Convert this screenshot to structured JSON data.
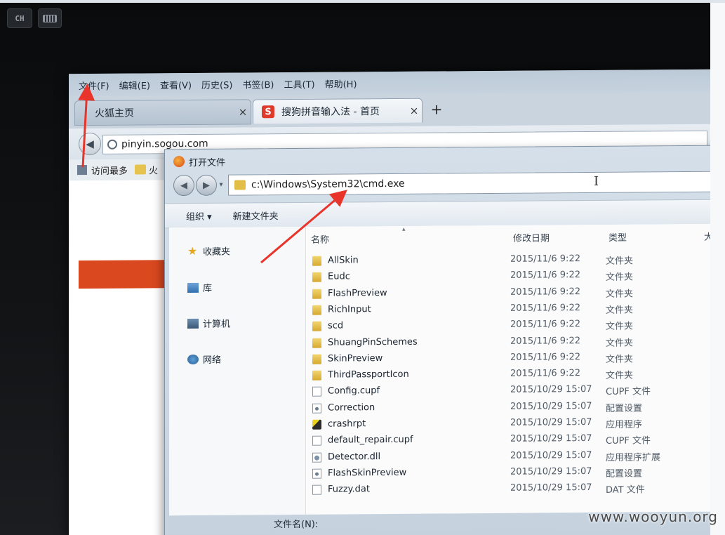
{
  "keyboard": {
    "lang": "CH"
  },
  "browser": {
    "menu": [
      "文件(F)",
      "编辑(E)",
      "查看(V)",
      "历史(S)",
      "书签(B)",
      "工具(T)",
      "帮助(H)"
    ],
    "tabs": [
      {
        "label": "火狐主页",
        "close": "×"
      },
      {
        "label": "搜狗拼音输入法 - 首页",
        "close": "×"
      }
    ],
    "new_tab": "+",
    "url": "pinyin.sogou.com",
    "bookmarks": [
      "访问最多",
      "火"
    ]
  },
  "dialog": {
    "title": "打开文件",
    "path": "c:\\Windows\\System32\\cmd.exe",
    "toolbar": {
      "organize": "组织 ▾",
      "new_folder": "新建文件夹"
    },
    "sidebar": [
      "收藏夹",
      "库",
      "计算机",
      "网络"
    ],
    "columns": {
      "name": "名称",
      "date": "修改日期",
      "type": "类型",
      "extra": "大"
    },
    "files": [
      {
        "name": "AllSkin",
        "date": "2015/11/6 9:22",
        "type": "文件夹",
        "icon": "folder"
      },
      {
        "name": "Eudc",
        "date": "2015/11/6 9:22",
        "type": "文件夹",
        "icon": "folder"
      },
      {
        "name": "FlashPreview",
        "date": "2015/11/6 9:22",
        "type": "文件夹",
        "icon": "folder"
      },
      {
        "name": "RichInput",
        "date": "2015/11/6 9:22",
        "type": "文件夹",
        "icon": "folder"
      },
      {
        "name": "scd",
        "date": "2015/11/6 9:22",
        "type": "文件夹",
        "icon": "folder"
      },
      {
        "name": "ShuangPinSchemes",
        "date": "2015/11/6 9:22",
        "type": "文件夹",
        "icon": "folder"
      },
      {
        "name": "SkinPreview",
        "date": "2015/11/6 9:22",
        "type": "文件夹",
        "icon": "folder"
      },
      {
        "name": "ThirdPassportIcon",
        "date": "2015/11/6 9:22",
        "type": "文件夹",
        "icon": "folder"
      },
      {
        "name": "Config.cupf",
        "date": "2015/10/29 15:07",
        "type": "CUPF 文件",
        "icon": "file"
      },
      {
        "name": "Correction",
        "date": "2015/10/29 15:07",
        "type": "配置设置",
        "icon": "cfg"
      },
      {
        "name": "crashrpt",
        "date": "2015/10/29 15:07",
        "type": "应用程序",
        "icon": "exe"
      },
      {
        "name": "default_repair.cupf",
        "date": "2015/10/29 15:07",
        "type": "CUPF 文件",
        "icon": "file"
      },
      {
        "name": "Detector.dll",
        "date": "2015/10/29 15:07",
        "type": "应用程序扩展",
        "icon": "dll"
      },
      {
        "name": "FlashSkinPreview",
        "date": "2015/10/29 15:07",
        "type": "配置设置",
        "icon": "cfg"
      },
      {
        "name": "Fuzzy.dat",
        "date": "2015/10/29 15:07",
        "type": "DAT 文件",
        "icon": "file"
      }
    ],
    "filename_label": "文件名(N):"
  },
  "watermark": "www.wooyun.org",
  "colors": {
    "arrow": "#e8342b",
    "accent": "#d9481f"
  }
}
